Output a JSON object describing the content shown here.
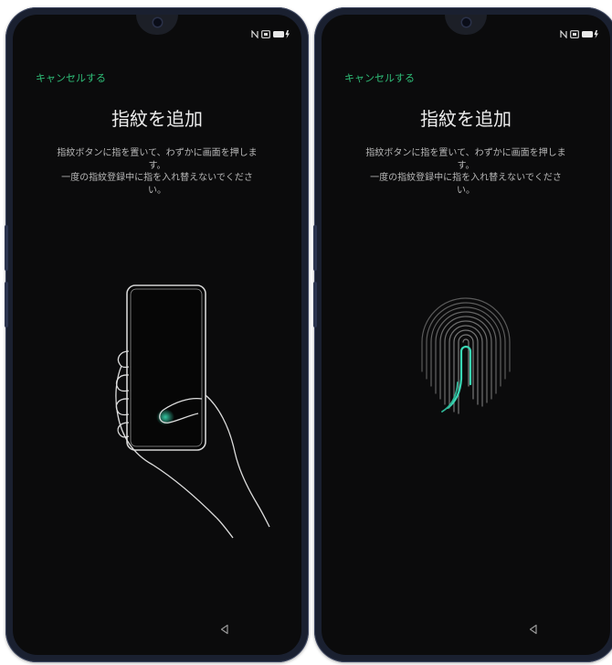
{
  "screens": [
    {
      "cancel_label": "キャンセルする",
      "title": "指紋を追加",
      "instruction_line1": "指紋ボタンに指を置いて、わずかに画面を押しま",
      "instruction_line2": "す。",
      "instruction_line3": "一度の指紋登録中に指を入れ替えないでくださ",
      "instruction_line4": "い。"
    },
    {
      "cancel_label": "キャンセルする",
      "title": "指紋を追加",
      "instruction_line1": "指紋ボタンに指を置いて、わずかに画面を押しま",
      "instruction_line2": "す。",
      "instruction_line3": "一度の指紋登録中に指を入れ替えないでくださ",
      "instruction_line4": "い。"
    }
  ],
  "status_icons": [
    "nfc-icon",
    "sim-icon",
    "battery-charging-icon"
  ],
  "illustrations": [
    "hand-holding-phone-illustration",
    "fingerprint-illustration"
  ],
  "navigation": {
    "back_icon": "back-triangle-icon"
  },
  "colors": {
    "accent": "#2fbf79",
    "screen_background": "#0b0b0c",
    "title": "#ececec",
    "body_text": "#b7b7b7",
    "fingerprint_highlight": "#3ad6b4",
    "phone_frame": "#1a2030"
  }
}
